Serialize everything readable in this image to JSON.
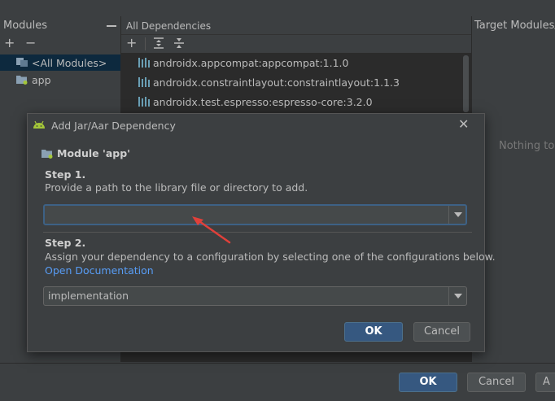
{
  "modules_panel": {
    "title": "Modules",
    "add_glyph": "+",
    "remove_glyph": "−",
    "items": [
      {
        "label": "<All Modules>",
        "selected": true,
        "icon": "all-modules-icon"
      },
      {
        "label": "app",
        "selected": false,
        "icon": "module-folder-icon"
      }
    ]
  },
  "dependencies_panel": {
    "title": "All Dependencies",
    "add_glyph": "+",
    "items": [
      {
        "label": "androidx.appcompat:appcompat:1.1.0"
      },
      {
        "label": "androidx.constraintlayout:constraintlayout:1.1.3"
      },
      {
        "label": "androidx.test.espresso:espresso-core:3.2.0"
      }
    ]
  },
  "target_panel": {
    "title": "Target Modules/",
    "empty_text": "Nothing to"
  },
  "bottom_bar": {
    "ok_label": "OK",
    "cancel_label": "Cancel",
    "apply_label": "A"
  },
  "dialog": {
    "title": "Add Jar/Aar Dependency",
    "close_glyph": "✕",
    "module_label": "Module 'app'",
    "step1_title": "Step 1.",
    "step1_desc": "Provide a path to the library file or directory to add.",
    "path_value": "",
    "step2_title": "Step 2.",
    "step2_desc": "Assign your dependency to a configuration by selecting one of the configurations below.",
    "docs_link": "Open Documentation",
    "configuration_value": "implementation",
    "ok_label": "OK",
    "cancel_label": "Cancel"
  },
  "colors": {
    "accent": "#365880",
    "link": "#589df6",
    "annotation": "#e0403a",
    "android_green": "#a4c639"
  }
}
